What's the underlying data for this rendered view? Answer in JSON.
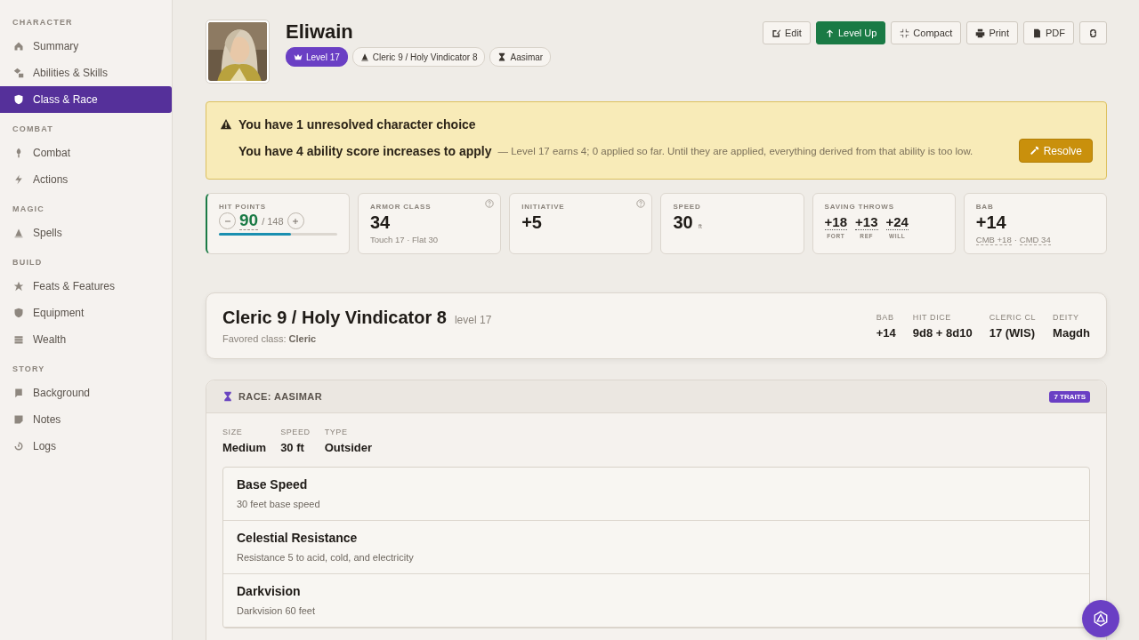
{
  "sidebar": {
    "sections": [
      {
        "title": "CHARACTER",
        "items": [
          {
            "label": "Summary",
            "selected": false
          },
          {
            "label": "Abilities & Skills",
            "selected": false
          },
          {
            "label": "Class & Race",
            "selected": true
          }
        ]
      },
      {
        "title": "COMBAT",
        "items": [
          {
            "label": "Combat",
            "selected": false
          },
          {
            "label": "Actions",
            "selected": false
          }
        ]
      },
      {
        "title": "MAGIC",
        "items": [
          {
            "label": "Spells",
            "selected": false
          }
        ]
      },
      {
        "title": "BUILD",
        "items": [
          {
            "label": "Feats & Features",
            "selected": false
          },
          {
            "label": "Equipment",
            "selected": false
          },
          {
            "label": "Wealth",
            "selected": false
          }
        ]
      },
      {
        "title": "STORY",
        "items": [
          {
            "label": "Background",
            "selected": false
          },
          {
            "label": "Notes",
            "selected": false
          },
          {
            "label": "Logs",
            "selected": false
          }
        ]
      }
    ]
  },
  "character": {
    "name": "Eliwain",
    "chips": [
      {
        "label": "Level 17",
        "kind": "level"
      },
      {
        "label": "Cleric 9 / Holy Vindicator 8",
        "kind": "class"
      },
      {
        "label": "Aasimar",
        "kind": "race"
      }
    ]
  },
  "actions": [
    {
      "label": "Edit",
      "kind": "edit"
    },
    {
      "label": "Level Up",
      "kind": "primary"
    },
    {
      "label": "Compact",
      "kind": "compact"
    },
    {
      "label": "Print",
      "kind": "print"
    },
    {
      "label": "PDF",
      "kind": "pdf"
    },
    {
      "kind": "refresh"
    }
  ],
  "alert": {
    "title": "You have 1 unresolved character choice",
    "headline": "You have 4 ability score increases to apply",
    "detail": "— Level 17 earns 4; 0 applied so far. Until they are applied, everything derived from that ability is too low.",
    "button": "Resolve"
  },
  "stats": [
    {
      "kind": "hp",
      "label": "HIT POINTS",
      "value": "90",
      "max": "/ 148",
      "level": 0.608
    },
    {
      "kind": "basic",
      "label": "ARMOR CLASS",
      "value": "34",
      "sub": "Touch 17 · Flat 30",
      "help": true
    },
    {
      "kind": "basic",
      "label": "INITIATIVE",
      "value": "+5",
      "help": true
    },
    {
      "kind": "basic",
      "label": "SPEED",
      "value": "30",
      "unit": "ft"
    },
    {
      "kind": "saves",
      "label": "SAVING THROWS",
      "saves": [
        {
          "value": "+18",
          "label": "FORT"
        },
        {
          "value": "+13",
          "label": "REF"
        },
        {
          "value": "+24",
          "label": "WILL"
        }
      ]
    },
    {
      "kind": "bab",
      "label": "BAB",
      "value": "+14",
      "links": [
        "CMB +18",
        "CMD 34"
      ],
      "separator": "·"
    }
  ],
  "class_card": {
    "title": "Cleric 9 / Holy Vindicator 8",
    "level": "level 17",
    "favored_label": "Favored class:",
    "favored": "Cleric",
    "facts": [
      {
        "label": "BAB",
        "value": "+14"
      },
      {
        "label": "HIT DICE",
        "value": "9d8 + 8d10"
      },
      {
        "label": "CLERIC CL",
        "value": "17 (WIS)"
      },
      {
        "label": "DEITY",
        "value": "Magdh"
      }
    ]
  },
  "race": {
    "title": "RACE: AASIMAR",
    "badge": "7 TRAITS",
    "facts": [
      {
        "label": "SIZE",
        "value": "Medium"
      },
      {
        "label": "SPEED",
        "value": "30 ft"
      },
      {
        "label": "TYPE",
        "value": "Outsider"
      }
    ],
    "traits": [
      {
        "name": "Base Speed",
        "text": "30 feet base speed"
      },
      {
        "name": "Celestial Resistance",
        "text": "Resistance 5 to acid, cold, and electricity"
      },
      {
        "name": "Darkvision",
        "text": "Darkvision 60 feet"
      }
    ]
  }
}
